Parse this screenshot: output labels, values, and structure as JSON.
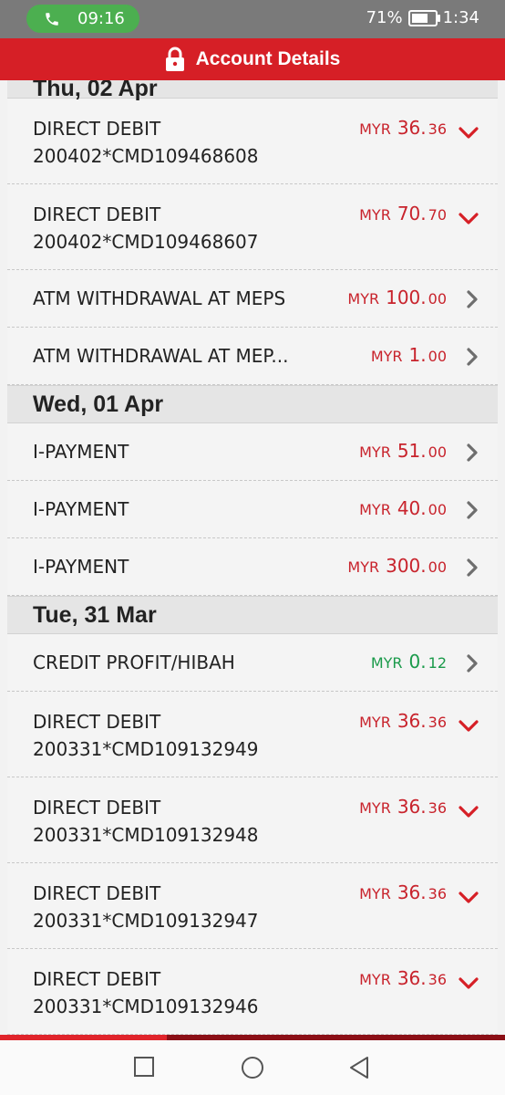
{
  "status_bar": {
    "call_time": "09:16",
    "battery": "71%",
    "battery_level": 0.71,
    "clock": "1:34"
  },
  "header": {
    "title": "Account Details"
  },
  "sections": [
    {
      "date": "Thu, 02 Apr",
      "items": [
        {
          "desc": "DIRECT DEBIT",
          "ref": "200402*CMD109468608",
          "currency": "MYR",
          "int": "36.",
          "dec": "36",
          "type": "debit",
          "chevron": "down"
        },
        {
          "desc": "DIRECT DEBIT",
          "ref": "200402*CMD109468607",
          "currency": "MYR",
          "int": "70.",
          "dec": "70",
          "type": "debit",
          "chevron": "down"
        },
        {
          "desc": "ATM WITHDRAWAL AT MEPS",
          "ref": "",
          "currency": "MYR",
          "int": "100.",
          "dec": "00",
          "type": "debit",
          "chevron": "right"
        },
        {
          "desc": "ATM WITHDRAWAL AT MEP...",
          "ref": "",
          "currency": "MYR",
          "int": "1.",
          "dec": "00",
          "type": "debit",
          "chevron": "right"
        }
      ]
    },
    {
      "date": "Wed, 01 Apr",
      "items": [
        {
          "desc": "I-PAYMENT",
          "ref": "",
          "currency": "MYR",
          "int": "51.",
          "dec": "00",
          "type": "debit",
          "chevron": "right"
        },
        {
          "desc": "I-PAYMENT",
          "ref": "",
          "currency": "MYR",
          "int": "40.",
          "dec": "00",
          "type": "debit",
          "chevron": "right"
        },
        {
          "desc": "I-PAYMENT",
          "ref": "",
          "currency": "MYR",
          "int": "300.",
          "dec": "00",
          "type": "debit",
          "chevron": "right"
        }
      ]
    },
    {
      "date": "Tue, 31 Mar",
      "items": [
        {
          "desc": "CREDIT PROFIT/HIBAH",
          "ref": "",
          "currency": "MYR",
          "int": "0.",
          "dec": "12",
          "type": "credit",
          "chevron": "right"
        },
        {
          "desc": "DIRECT DEBIT",
          "ref": "200331*CMD109132949",
          "currency": "MYR",
          "int": "36.",
          "dec": "36",
          "type": "debit",
          "chevron": "down"
        },
        {
          "desc": "DIRECT DEBIT",
          "ref": "200331*CMD109132948",
          "currency": "MYR",
          "int": "36.",
          "dec": "36",
          "type": "debit",
          "chevron": "down"
        },
        {
          "desc": "DIRECT DEBIT",
          "ref": "200331*CMD109132947",
          "currency": "MYR",
          "int": "36.",
          "dec": "36",
          "type": "debit",
          "chevron": "down"
        },
        {
          "desc": "DIRECT DEBIT",
          "ref": "200331*CMD109132946",
          "currency": "MYR",
          "int": "36.",
          "dec": "36",
          "type": "debit",
          "chevron": "down"
        }
      ]
    }
  ],
  "progress": 0.33,
  "colors": {
    "brand": "#d61f26",
    "debit": "#c8232c",
    "credit": "#1a9a4a",
    "chevron_down": "#d61f26",
    "chevron_right": "#6e6e6e"
  },
  "icons": {
    "call": "phone-icon",
    "lock": "lock-icon",
    "nav_recent": "square-icon",
    "nav_home": "circle-icon",
    "nav_back": "triangle-back-icon"
  }
}
